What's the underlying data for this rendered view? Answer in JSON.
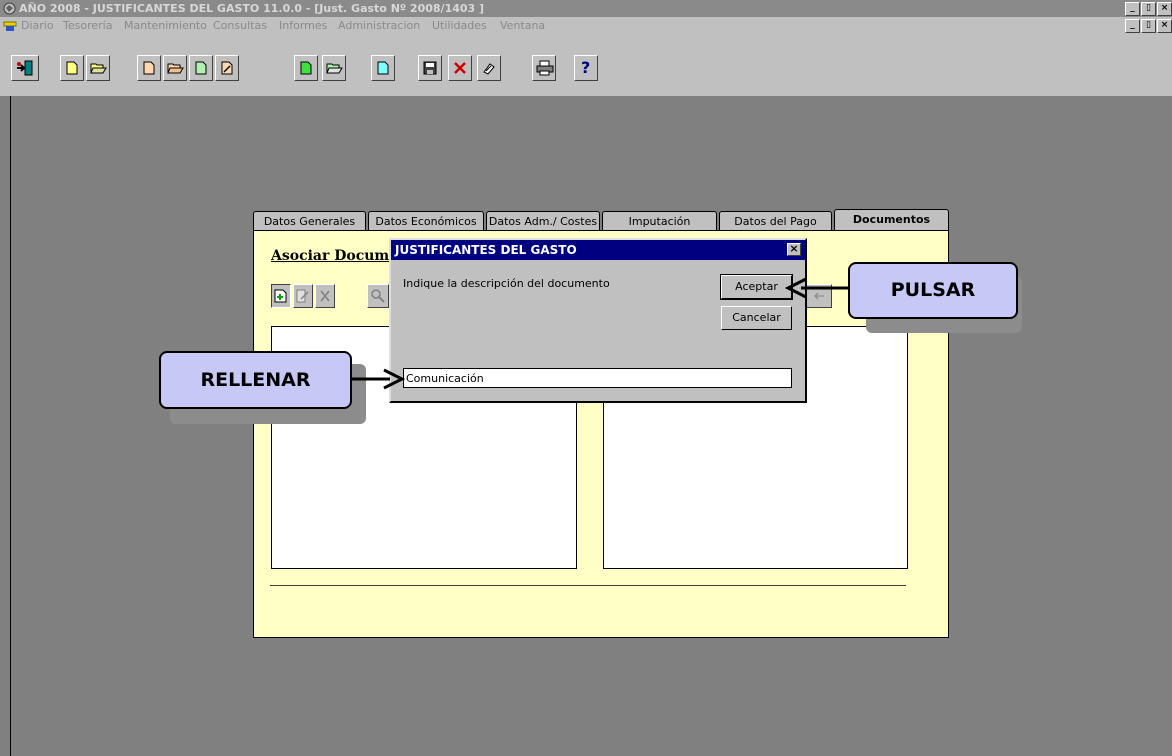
{
  "window": {
    "title": "AÑO 2008 - JUSTIFICANTES DEL GASTO 11.0.0 - [Just. Gasto Nº 2008/1403   ]",
    "controls": [
      "_",
      "▯",
      "×"
    ]
  },
  "menu": {
    "items": [
      "Diario",
      "Tesorería",
      "Mantenimiento",
      "Consultas",
      "Informes",
      "Administracion",
      "Utilidades",
      "Ventana"
    ]
  },
  "toolbar": {
    "icons": [
      "exit-icon",
      "new-doc-icon",
      "open-folder-icon",
      "new-doc-icon",
      "open-folder-icon",
      "doc-icon",
      "edit-doc-icon",
      "new-green-doc-icon",
      "open-folder-icon",
      "cyan-doc-icon",
      "save-icon",
      "delete-icon",
      "search-icon",
      "print-icon",
      "help-icon"
    ],
    "help_label": "?"
  },
  "tabs": [
    {
      "label": "Datos Generales"
    },
    {
      "label": "Datos Económicos"
    },
    {
      "label": "Datos Adm./ Costes"
    },
    {
      "label": "Imputación"
    },
    {
      "label": "Datos del Pago"
    },
    {
      "label": "Documentos",
      "active": true
    }
  ],
  "panel": {
    "heading": "Asociar Docum"
  },
  "dialog": {
    "title": "JUSTIFICANTES DEL GASTO",
    "close": "×",
    "prompt": "Indique la descripción del documento",
    "accept_label": "Aceptar",
    "cancel_label": "Cancelar",
    "input_value": "Comunicación"
  },
  "callouts": {
    "fill": "RELLENAR",
    "press": "PULSAR"
  },
  "colors": {
    "panel_bg": "#ffffc6",
    "dialog_title_bg": "#000080",
    "callout_bg": "#c8c8f6",
    "desktop_bg": "#808080"
  }
}
